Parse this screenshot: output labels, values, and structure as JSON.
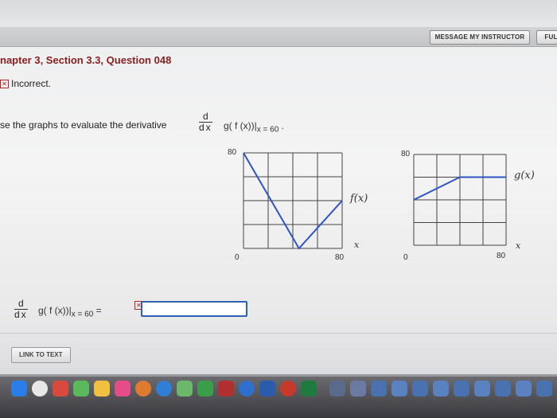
{
  "header": {
    "message_button": "MESSAGE MY INSTRUCTOR",
    "full_button": "FULL"
  },
  "question": {
    "title": "napter 3, Section 3.3, Question 048",
    "status": "Incorrect.",
    "status_icon": "x-mark-icon",
    "prompt": "se the graphs to evaluate the derivative",
    "deriv_num": "d",
    "deriv_den": "dx",
    "expr_body": "g( f (x))|",
    "expr_sub": "x = 60",
    "expr_end": ".",
    "equals": "="
  },
  "graphs": {
    "f": {
      "label": "f(x)",
      "y_top": "80",
      "origin": "0",
      "x_max": "80",
      "x_axis": "x",
      "points": [
        [
          0,
          80
        ],
        [
          45,
          0
        ],
        [
          80,
          40
        ]
      ]
    },
    "g": {
      "label": "g(x)",
      "y_top": "80",
      "origin": "0",
      "x_max": "80",
      "x_axis": "x",
      "points": [
        [
          0,
          40
        ],
        [
          40,
          60
        ],
        [
          80,
          60
        ]
      ]
    }
  },
  "answer": {
    "value": "",
    "link_label": "LINK TO TEXT"
  },
  "colors": {
    "title": "#8a2020",
    "curve": "#2e54c4",
    "input_border": "#2e60b6"
  }
}
